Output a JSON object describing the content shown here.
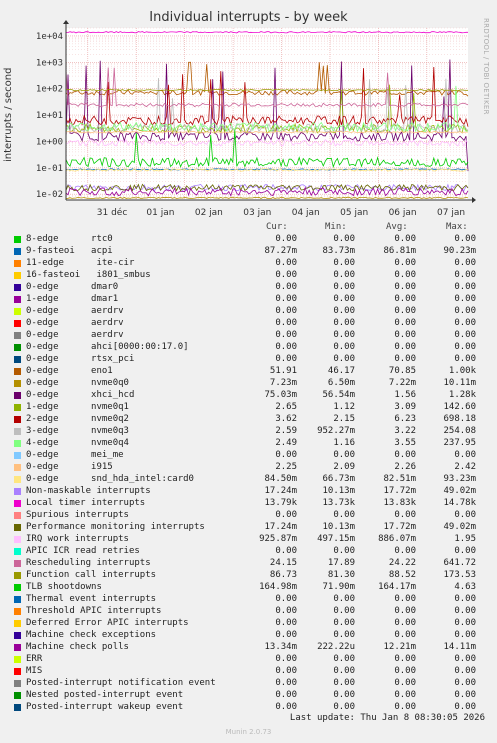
{
  "chart_data": {
    "type": "line",
    "title": "Individual interrupts - by week",
    "ylabel": "interrupts / second",
    "y_scale": "log",
    "ylim": [
      0.006,
      20000
    ],
    "y_ticks": [
      "1e-02",
      "1e-01",
      "1e+00",
      "1e+01",
      "1e+02",
      "1e+03",
      "1e+04"
    ],
    "x_ticks": [
      "31 déc",
      "01 jan",
      "02 jan",
      "03 jan",
      "04 jan",
      "05 jan",
      "06 jan",
      "07 jan"
    ],
    "grid": true,
    "side_note": "RRDTOOL / TOBI OETIKER",
    "legend_headers": [
      "Cur:",
      "Min:",
      "Avg:",
      "Max:"
    ],
    "series": [
      {
        "name": "8-edge      rtc0",
        "color": "#00cc00",
        "cur": "0.00",
        "min": "0.00",
        "avg": "0.00",
        "max": "0.00"
      },
      {
        "name": "9-fasteoi   acpi",
        "color": "#0066b3",
        "cur": "87.27m",
        "min": "83.73m",
        "avg": "86.81m",
        "max": "90.23m"
      },
      {
        "name": "11-edge      ite-cir",
        "color": "#ff8000",
        "cur": "0.00",
        "min": "0.00",
        "avg": "0.00",
        "max": "0.00"
      },
      {
        "name": "16-fasteoi   i801_smbus",
        "color": "#ffcc00",
        "cur": "0.00",
        "min": "0.00",
        "avg": "0.00",
        "max": "0.00"
      },
      {
        "name": "0-edge      dmar0",
        "color": "#330099",
        "cur": "0.00",
        "min": "0.00",
        "avg": "0.00",
        "max": "0.00"
      },
      {
        "name": "1-edge      dmar1",
        "color": "#990099",
        "cur": "0.00",
        "min": "0.00",
        "avg": "0.00",
        "max": "0.00"
      },
      {
        "name": "0-edge      aerdrv",
        "color": "#ccff00",
        "cur": "0.00",
        "min": "0.00",
        "avg": "0.00",
        "max": "0.00"
      },
      {
        "name": "0-edge      aerdrv",
        "color": "#ff0000",
        "cur": "0.00",
        "min": "0.00",
        "avg": "0.00",
        "max": "0.00"
      },
      {
        "name": "0-edge      aerdrv",
        "color": "#808080",
        "cur": "0.00",
        "min": "0.00",
        "avg": "0.00",
        "max": "0.00"
      },
      {
        "name": "0-edge      ahci[0000:00:17.0]",
        "color": "#008f00",
        "cur": "0.00",
        "min": "0.00",
        "avg": "0.00",
        "max": "0.00"
      },
      {
        "name": "0-edge      rtsx_pci",
        "color": "#00487d",
        "cur": "0.00",
        "min": "0.00",
        "avg": "0.00",
        "max": "0.00"
      },
      {
        "name": "0-edge      eno1",
        "color": "#b35a00",
        "cur": "51.91",
        "min": "46.17",
        "avg": "70.85",
        "max": "1.00k"
      },
      {
        "name": "0-edge      nvme0q0",
        "color": "#b38f00",
        "cur": "7.23m",
        "min": "6.50m",
        "avg": "7.22m",
        "max": "10.11m"
      },
      {
        "name": "0-edge      xhci_hcd",
        "color": "#6b006b",
        "cur": "75.03m",
        "min": "56.54m",
        "avg": "1.56",
        "max": "1.28k"
      },
      {
        "name": "1-edge      nvme0q1",
        "color": "#8fb300",
        "cur": "2.65",
        "min": "1.12",
        "avg": "3.09",
        "max": "142.60"
      },
      {
        "name": "2-edge      nvme0q2",
        "color": "#b30000",
        "cur": "3.62",
        "min": "2.15",
        "avg": "6.23",
        "max": "698.18"
      },
      {
        "name": "3-edge      nvme0q3",
        "color": "#bebebe",
        "cur": "2.59",
        "min": "952.27m",
        "avg": "3.22",
        "max": "254.08"
      },
      {
        "name": "4-edge      nvme0q4",
        "color": "#80ff80",
        "cur": "2.49",
        "min": "1.16",
        "avg": "3.55",
        "max": "237.95"
      },
      {
        "name": "0-edge      mei_me",
        "color": "#80c9ff",
        "cur": "0.00",
        "min": "0.00",
        "avg": "0.00",
        "max": "0.00"
      },
      {
        "name": "0-edge      i915",
        "color": "#ffc080",
        "cur": "2.25",
        "min": "2.09",
        "avg": "2.26",
        "max": "2.42"
      },
      {
        "name": "0-edge      snd_hda_intel:card0",
        "color": "#ffe680",
        "cur": "84.50m",
        "min": "66.73m",
        "avg": "82.51m",
        "max": "93.23m"
      },
      {
        "name": "Non-maskable interrupts",
        "color": "#aa80ff",
        "cur": "17.24m",
        "min": "10.13m",
        "avg": "17.72m",
        "max": "49.02m"
      },
      {
        "name": "Local timer interrupts",
        "color": "#ee00cc",
        "cur": "13.79k",
        "min": "13.73k",
        "avg": "13.83k",
        "max": "14.78k"
      },
      {
        "name": "Spurious interrupts",
        "color": "#ff8080",
        "cur": "0.00",
        "min": "0.00",
        "avg": "0.00",
        "max": "0.00"
      },
      {
        "name": "Performance monitoring interrupts",
        "color": "#666600",
        "cur": "17.24m",
        "min": "10.13m",
        "avg": "17.72m",
        "max": "49.02m"
      },
      {
        "name": "IRQ work interrupts",
        "color": "#ffbfff",
        "cur": "925.87m",
        "min": "497.15m",
        "avg": "886.07m",
        "max": "1.95"
      },
      {
        "name": "APIC ICR read retries",
        "color": "#00ffcc",
        "cur": "0.00",
        "min": "0.00",
        "avg": "0.00",
        "max": "0.00"
      },
      {
        "name": "Rescheduling interrupts",
        "color": "#cc6699",
        "cur": "24.15",
        "min": "17.89",
        "avg": "24.22",
        "max": "641.72"
      },
      {
        "name": "Function call interrupts",
        "color": "#999900",
        "cur": "86.73",
        "min": "81.30",
        "avg": "88.52",
        "max": "173.53"
      },
      {
        "name": "TLB shootdowns",
        "color": "#00cc00",
        "cur": "164.98m",
        "min": "71.90m",
        "avg": "164.17m",
        "max": "4.63"
      },
      {
        "name": "Thermal event interrupts",
        "color": "#0066b3",
        "cur": "0.00",
        "min": "0.00",
        "avg": "0.00",
        "max": "0.00"
      },
      {
        "name": "Threshold APIC interrupts",
        "color": "#ff8000",
        "cur": "0.00",
        "min": "0.00",
        "avg": "0.00",
        "max": "0.00"
      },
      {
        "name": "Deferred Error APIC interrupts",
        "color": "#ffcc00",
        "cur": "0.00",
        "min": "0.00",
        "avg": "0.00",
        "max": "0.00"
      },
      {
        "name": "Machine check exceptions",
        "color": "#330099",
        "cur": "0.00",
        "min": "0.00",
        "avg": "0.00",
        "max": "0.00"
      },
      {
        "name": "Machine check polls",
        "color": "#990099",
        "cur": "13.34m",
        "min": "222.22u",
        "avg": "12.21m",
        "max": "14.11m"
      },
      {
        "name": "ERR",
        "color": "#ccff00",
        "cur": "0.00",
        "min": "0.00",
        "avg": "0.00",
        "max": "0.00"
      },
      {
        "name": "MIS",
        "color": "#ff0000",
        "cur": "0.00",
        "min": "0.00",
        "avg": "0.00",
        "max": "0.00"
      },
      {
        "name": "Posted-interrupt notification event",
        "color": "#808080",
        "cur": "0.00",
        "min": "0.00",
        "avg": "0.00",
        "max": "0.00"
      },
      {
        "name": "Nested posted-interrupt event",
        "color": "#008f00",
        "cur": "0.00",
        "min": "0.00",
        "avg": "0.00",
        "max": "0.00"
      },
      {
        "name": "Posted-interrupt wakeup event",
        "color": "#00487d",
        "cur": "0.00",
        "min": "0.00",
        "avg": "0.00",
        "max": "0.00"
      }
    ]
  },
  "footer": {
    "last_update": "Last update: Thu Jan  8 08:30:05 2026",
    "version": "Munin 2.0.73"
  }
}
